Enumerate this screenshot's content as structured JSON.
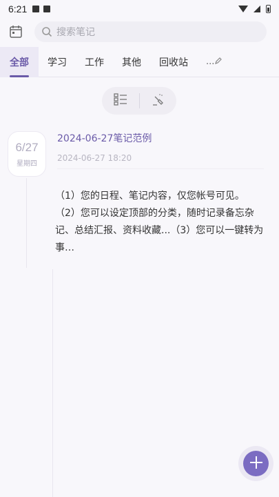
{
  "status_bar": {
    "time": "6:21"
  },
  "search": {
    "placeholder": "搜索笔记"
  },
  "tabs": [
    {
      "label": "全部",
      "active": true
    },
    {
      "label": "学习",
      "active": false
    },
    {
      "label": "工作",
      "active": false
    },
    {
      "label": "其他",
      "active": false
    },
    {
      "label": "回收站",
      "active": false
    }
  ],
  "tabs_more_label": "...",
  "note": {
    "date_day": "6/27",
    "date_weekday": "星期四",
    "title": "2024-06-27笔记范例",
    "timestamp": "2024-06-27 18:20",
    "body_lines": [
      "（1）您的日程、笔记内容，仅您帐号可见。",
      "（2）您可以设定顶部的分类，随时记录备忘杂",
      "记、总结汇报、资料收藏...（3）您可以一键转为",
      "事…"
    ]
  },
  "colors": {
    "accent": "#6a5aa8",
    "fab": "#7b6cc2"
  },
  "icons": {
    "calendar": "calendar-icon",
    "search": "search-icon",
    "list_view": "list-view-icon",
    "clean": "broom-icon",
    "edit": "pencil-icon",
    "add": "plus-icon"
  }
}
